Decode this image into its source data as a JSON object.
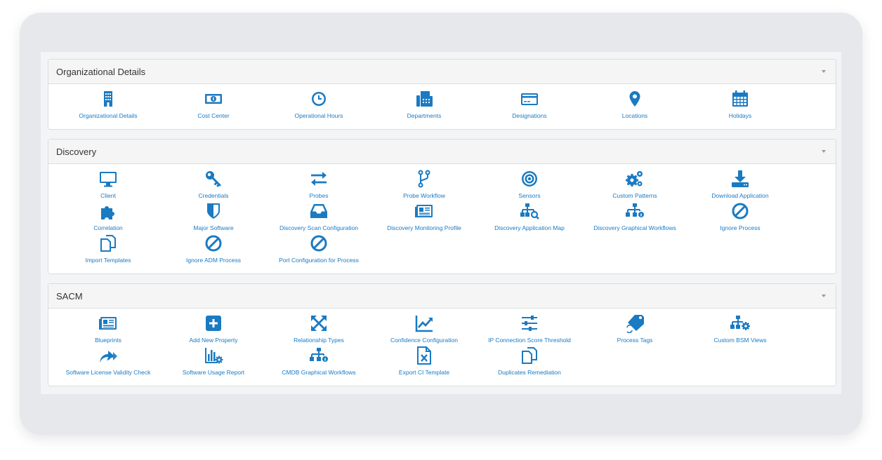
{
  "colors": {
    "accent": "#1a7ac2",
    "panel_header": "#f5f5f5",
    "frame": "#e6e8ec"
  },
  "sections": [
    {
      "title": "Organizational Details",
      "items": [
        {
          "label": "Organizational Details",
          "icon": "building-icon"
        },
        {
          "label": "Cost Center",
          "icon": "money-icon"
        },
        {
          "label": "Operational Hours",
          "icon": "clock-icon"
        },
        {
          "label": "Departments",
          "icon": "fax-icon"
        },
        {
          "label": "Designations",
          "icon": "credit-card-icon"
        },
        {
          "label": "Locations",
          "icon": "map-marker-icon"
        },
        {
          "label": "Holidays",
          "icon": "calendar-icon"
        }
      ]
    },
    {
      "title": "Discovery",
      "items": [
        {
          "label": "Client",
          "icon": "monitor-icon"
        },
        {
          "label": "Credentials",
          "icon": "key-icon"
        },
        {
          "label": "Probes",
          "icon": "exchange-icon"
        },
        {
          "label": "Probe Workflow",
          "icon": "code-fork-icon"
        },
        {
          "label": "Sensors",
          "icon": "bullseye-icon"
        },
        {
          "label": "Custom Patterns",
          "icon": "cogs-icon"
        },
        {
          "label": "Download Application",
          "icon": "download-icon"
        },
        {
          "label": "Correlation",
          "icon": "puzzle-icon"
        },
        {
          "label": "Major Software",
          "icon": "shield-icon"
        },
        {
          "label": "Discovery Scan Configuration",
          "icon": "inbox-icon"
        },
        {
          "label": "Discovery Monitoring Profile",
          "icon": "newspaper-icon"
        },
        {
          "label": "Discovery Application Map",
          "icon": "sitemap-search-icon"
        },
        {
          "label": "Discovery Graphical Workflows",
          "icon": "sitemap-info-icon"
        },
        {
          "label": "Ignore Process",
          "icon": "ban-icon"
        },
        {
          "label": "Import Templates",
          "icon": "copy-icon"
        },
        {
          "label": "Ignore ADM Process",
          "icon": "ban-icon"
        },
        {
          "label": "Port Configuration for Process",
          "icon": "ban-icon"
        }
      ]
    },
    {
      "title": "SACM",
      "items": [
        {
          "label": "Blueprints",
          "icon": "newspaper-icon"
        },
        {
          "label": "Add New Property",
          "icon": "plus-square-icon"
        },
        {
          "label": "Relationship Types",
          "icon": "arrows-expand-icon"
        },
        {
          "label": "Confidence Configuration",
          "icon": "line-chart-icon"
        },
        {
          "label": "IP Connection Score Threshold",
          "icon": "sliders-icon"
        },
        {
          "label": "Process Tags",
          "icon": "tag-refresh-icon"
        },
        {
          "label": "Custom BSM Views",
          "icon": "sitemap-cog-icon"
        },
        {
          "label": "Software License Validity Check",
          "icon": "share-icon"
        },
        {
          "label": "Software Usage Report",
          "icon": "bar-chart-cog-icon"
        },
        {
          "label": "CMDB Graphical Workflows",
          "icon": "sitemap-info-icon"
        },
        {
          "label": "Export CI Template",
          "icon": "file-excel-icon"
        },
        {
          "label": "Duplicates Remediation",
          "icon": "copy-icon"
        }
      ]
    }
  ]
}
